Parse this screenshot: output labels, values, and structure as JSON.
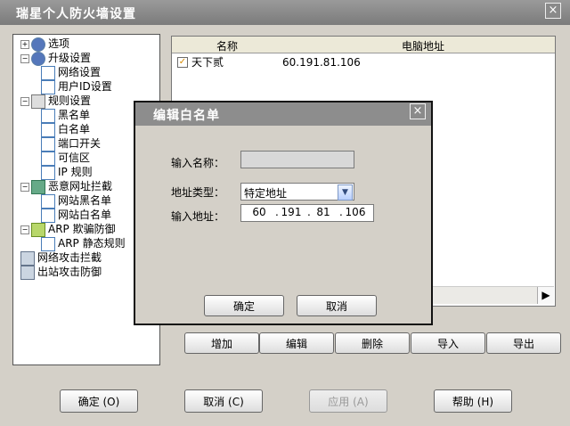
{
  "window": {
    "title": "瑞星个人防火墙设置",
    "close": "×"
  },
  "tree": [
    {
      "label": "选项",
      "indent": 0,
      "expander": "+",
      "icon": "gear-icon"
    },
    {
      "label": "升级设置",
      "indent": 0,
      "expander": "−",
      "icon": "upgrade-icon"
    },
    {
      "label": "网络设置",
      "indent": 1,
      "expander": "",
      "icon": "document-icon"
    },
    {
      "label": "用户ID设置",
      "indent": 1,
      "expander": "",
      "icon": "document-icon"
    },
    {
      "label": "规则设置",
      "indent": 0,
      "expander": "−",
      "icon": "rule-icon"
    },
    {
      "label": "黑名单",
      "indent": 1,
      "expander": "",
      "icon": "document-icon"
    },
    {
      "label": "白名单",
      "indent": 1,
      "expander": "",
      "icon": "document-icon"
    },
    {
      "label": "端口开关",
      "indent": 1,
      "expander": "",
      "icon": "document-icon"
    },
    {
      "label": "可信区",
      "indent": 1,
      "expander": "",
      "icon": "document-icon"
    },
    {
      "label": "IP 规则",
      "indent": 1,
      "expander": "",
      "icon": "document-icon"
    },
    {
      "label": "恶意网址拦截",
      "indent": 0,
      "expander": "−",
      "icon": "network-icon"
    },
    {
      "label": "网站黑名单",
      "indent": 1,
      "expander": "",
      "icon": "document-icon"
    },
    {
      "label": "网站白名单",
      "indent": 1,
      "expander": "",
      "icon": "document-icon"
    },
    {
      "label": "ARP 欺骗防御",
      "indent": 0,
      "expander": "−",
      "icon": "arp-icon"
    },
    {
      "label": "ARP 静态规则",
      "indent": 1,
      "expander": "",
      "icon": "document-icon"
    },
    {
      "label": "网络攻击拦截",
      "indent": 0,
      "expander": "",
      "icon": "computer-icon"
    },
    {
      "label": "出站攻击防御",
      "indent": 0,
      "expander": "",
      "icon": "computer-icon"
    }
  ],
  "list": {
    "columns": [
      "名称",
      "电脑地址"
    ],
    "rows": [
      {
        "checked": true,
        "name": "天下贰",
        "address": "60.191.81.106"
      }
    ]
  },
  "list_buttons": {
    "add": "增加",
    "edit": "编辑",
    "delete": "删除",
    "import": "导入",
    "export": "导出"
  },
  "bottom_buttons": {
    "ok": "确定 (O)",
    "cancel": "取消 (C)",
    "apply": "应用 (A)",
    "help": "帮助 (H)"
  },
  "dialog": {
    "title": "编辑白名单",
    "name_label": "输入名称：",
    "name_value": "",
    "type_label": "地址类型：",
    "type_value": "特定地址",
    "address_label": "输入地址：",
    "address_octets": [
      "60",
      "191",
      "81",
      "106"
    ],
    "ok": "确定",
    "cancel": "取消"
  },
  "colors": {
    "check": "#d68a00",
    "title_text": "#ffffff"
  }
}
